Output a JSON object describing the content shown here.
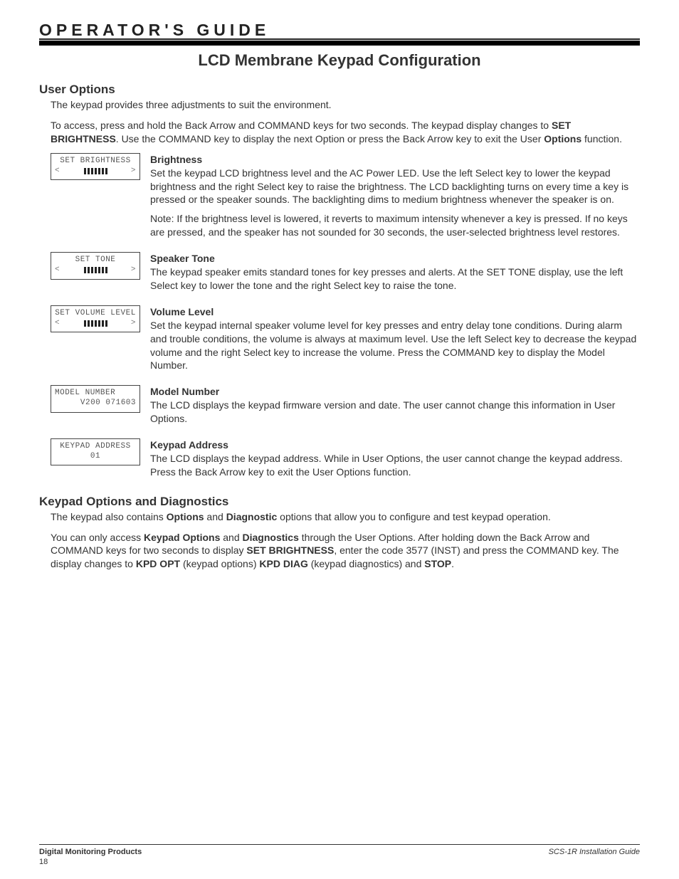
{
  "header": {
    "guide": "OPERATOR'S GUIDE"
  },
  "title": "LCD Membrane Keypad Configuration",
  "section1": {
    "heading": "User Options",
    "intro": "The keypad provides three adjustments to suit the environment.",
    "access_pre": "To access, press and hold the Back Arrow and COMMAND keys for two seconds.  The keypad display changes to ",
    "access_b1": "SET BRIGHTNESS",
    "access_mid": ".  Use the COMMAND key to display the next Option or press the Back Arrow key to exit the User ",
    "access_b2": "Options",
    "access_post": " function."
  },
  "brightness": {
    "lcd_l1": "SET BRIGHTNESS",
    "heading": "Brightness",
    "p1": "Set the keypad LCD brightness level and the AC Power LED.  Use the left Select key to lower the keypad brightness and the right Select key to raise the brightness.  The LCD backlighting turns on every time a key is pressed or the speaker sounds.  The backlighting dims to medium brightness whenever the speaker is on.",
    "note_b": "Note",
    "note_rest": ": If the brightness level is lowered, it reverts to maximum intensity whenever a key is pressed.  If no keys are pressed, and the speaker has not sounded for 30 seconds, the user-selected brightness level restores."
  },
  "tone": {
    "lcd_l1": "SET TONE",
    "heading": "Speaker Tone",
    "p1": "The keypad speaker emits standard tones for key presses and alerts.  At the SET TONE display, use the left Select key to lower the tone and the right Select key to raise the tone."
  },
  "volume": {
    "lcd_l1": "SET VOLUME LEVEL",
    "heading": "Volume Level",
    "p1": "Set the keypad internal speaker volume level for key presses and entry delay tone conditions.  During alarm and trouble conditions, the volume is always at maximum level.  Use the left Select key to decrease the keypad volume and the right Select key to increase the volume.  Press the COMMAND key to display the Model Number."
  },
  "model": {
    "lcd_l1": "MODEL NUMBER",
    "lcd_l2": "   V200 071603",
    "heading": "Model Number",
    "p1": "The LCD displays the keypad firmware version and date.  The user cannot change this information in User Options."
  },
  "addr": {
    "lcd_l1": "KEYPAD ADDRESS",
    "lcd_l2": "01",
    "heading": "Keypad Address",
    "p1": "The LCD displays the keypad address.  While in User Options, the user cannot change the keypad address.  Press the Back Arrow key to exit the User Options function."
  },
  "section2": {
    "heading": "Keypad Options and Diagnostics",
    "p1_pre": "The keypad also contains ",
    "p1_b1": "Options",
    "p1_mid1": " and ",
    "p1_b2": "Diagnostic",
    "p1_post": " options that allow you to configure and test keypad operation.",
    "p2_pre": "You can only access ",
    "p2_b1": "Keypad Options",
    "p2_mid1": " and ",
    "p2_b2": "Diagnostics",
    "p2_mid2": " through the User Options.  After holding down the Back Arrow and COMMAND keys for two seconds to display ",
    "p2_b3": "SET BRIGHTNESS",
    "p2_mid3": ", enter the code 3577 (INST) and press the COMMAND key.  The display changes to ",
    "p2_b4": "KPD OPT",
    "p2_mid4": " (keypad options) ",
    "p2_b5": "KPD DIAG",
    "p2_mid5": " (keypad diagnostics) and ",
    "p2_b6": "STOP",
    "p2_post": "."
  },
  "footer": {
    "left": "Digital Monitoring Products",
    "right": "SCS-1R Installation Guide",
    "page": "18"
  },
  "glyph": {
    "lt": "<",
    "gt": ">"
  }
}
